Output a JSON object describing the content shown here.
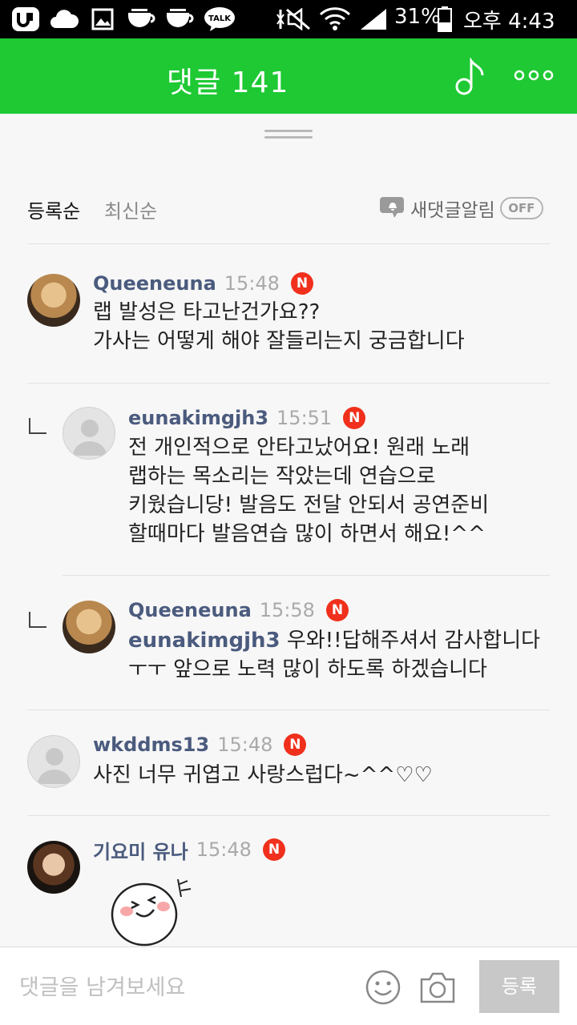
{
  "status_bar": {
    "battery": "31%",
    "time": "오후 4:43",
    "talk_label": "TALK"
  },
  "header": {
    "title": "댓글 141"
  },
  "sort": {
    "active": "등록순",
    "inactive": "최신순"
  },
  "notification": {
    "label": "새댓글알림",
    "toggle": "OFF"
  },
  "new_badge": "N",
  "comments": [
    {
      "nick": "Queeneuna",
      "time": "15:48",
      "lines": [
        "랩 발성은 타고난건가요??",
        "가사는 어떻게 해야 잘들리는지 궁금합니다"
      ]
    },
    {
      "nick": "eunakimgjh3",
      "time": "15:51",
      "lines": [
        "전 개인적으로 안타고났어요! 원래 노래",
        "랩하는 목소리는 작았는데 연습으로",
        "키웠습니당! 발음도 전달 안되서 공연준비",
        "할때마다 발음연습 많이 하면서 해요!^^"
      ]
    },
    {
      "nick": "Queeneuna",
      "time": "15:58",
      "mention": "eunakimgjh3",
      "lines": [
        "우와!!답해주셔서 감사합니다",
        "ㅜㅜ 앞으로 노력 많이 하도록 하겠습니다"
      ]
    },
    {
      "nick": "wkddms13",
      "time": "15:48",
      "lines": [
        "사진 너무 귀엽고 사랑스럽다~^^♡♡"
      ]
    },
    {
      "nick": "기요미 유나",
      "time": "15:48",
      "lines": []
    }
  ],
  "input": {
    "placeholder": "댓글을 남겨보세요",
    "submit_label": "등록"
  }
}
